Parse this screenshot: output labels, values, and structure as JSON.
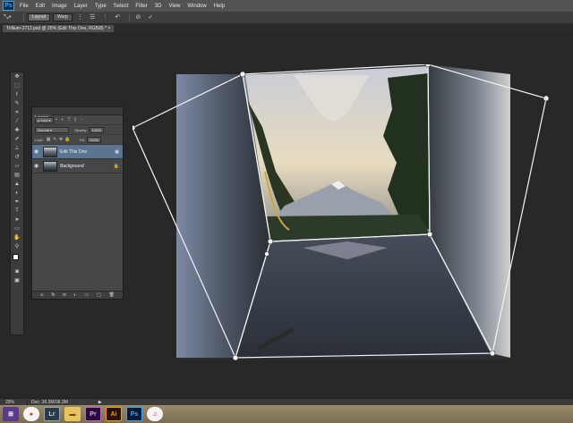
{
  "app": {
    "logo": "Ps"
  },
  "menu": [
    "File",
    "Edit",
    "Image",
    "Layer",
    "Type",
    "Select",
    "Filter",
    "3D",
    "View",
    "Window",
    "Help"
  ],
  "options": {
    "layout_label": "Layout",
    "warp_label": "Warp",
    "icons": [
      "transform-tool-icon",
      "pin-icon",
      "grid-icon",
      "grid-lines-icon",
      "straighten-icon",
      "undo-icon",
      "cancel-icon",
      "commit-icon"
    ]
  },
  "document": {
    "tab_title": "Trillium-2712.psd @ 25% (Edit This One, RGB/8) *"
  },
  "tools": [
    "move-icon",
    "marquee-icon",
    "lasso-icon",
    "quick-select-icon",
    "crop-icon",
    "eyedropper-icon",
    "healing-icon",
    "brush-icon",
    "clone-stamp-icon",
    "history-brush-icon",
    "eraser-icon",
    "gradient-icon",
    "blur-icon",
    "dodge-icon",
    "pen-icon",
    "type-icon",
    "path-select-icon",
    "rectangle-icon",
    "hand-icon",
    "zoom-icon"
  ],
  "colors": {
    "foreground": "#ffffff",
    "background": "#000000",
    "panel": "#474747",
    "selected_layer": "#5a7592",
    "warp_lines": "#f4f4f4"
  },
  "layers_panel": {
    "tab_label": "Layers",
    "filter_label": "Kind",
    "blend_mode": "Normal",
    "opacity_label": "Opacity:",
    "opacity_value": "100%",
    "lock_label": "Lock:",
    "fill_label": "Fill:",
    "fill_value": "100%",
    "layers": [
      {
        "name": "Edit This One",
        "selected": true,
        "visible": true
      },
      {
        "name": "Background",
        "selected": false,
        "visible": true,
        "locked": true
      }
    ],
    "footer_icons": [
      "link-icon",
      "fx-icon",
      "mask-icon",
      "adjustment-icon",
      "group-icon",
      "new-layer-icon",
      "trash-icon"
    ]
  },
  "status": {
    "zoom": "25%",
    "doc_info": "Doc: 36.3M/36.3M"
  },
  "taskbar": {
    "apps": [
      {
        "name": "start-icon",
        "label": ""
      },
      {
        "name": "chrome-icon",
        "label": ""
      },
      {
        "name": "lightroom-icon",
        "label": "Lr"
      },
      {
        "name": "folder-icon",
        "label": ""
      },
      {
        "name": "premiere-icon",
        "label": "Pr"
      },
      {
        "name": "illustrator-icon",
        "label": "Ai"
      },
      {
        "name": "photoshop-icon",
        "label": "Ps"
      },
      {
        "name": "itunes-icon",
        "label": ""
      }
    ]
  }
}
